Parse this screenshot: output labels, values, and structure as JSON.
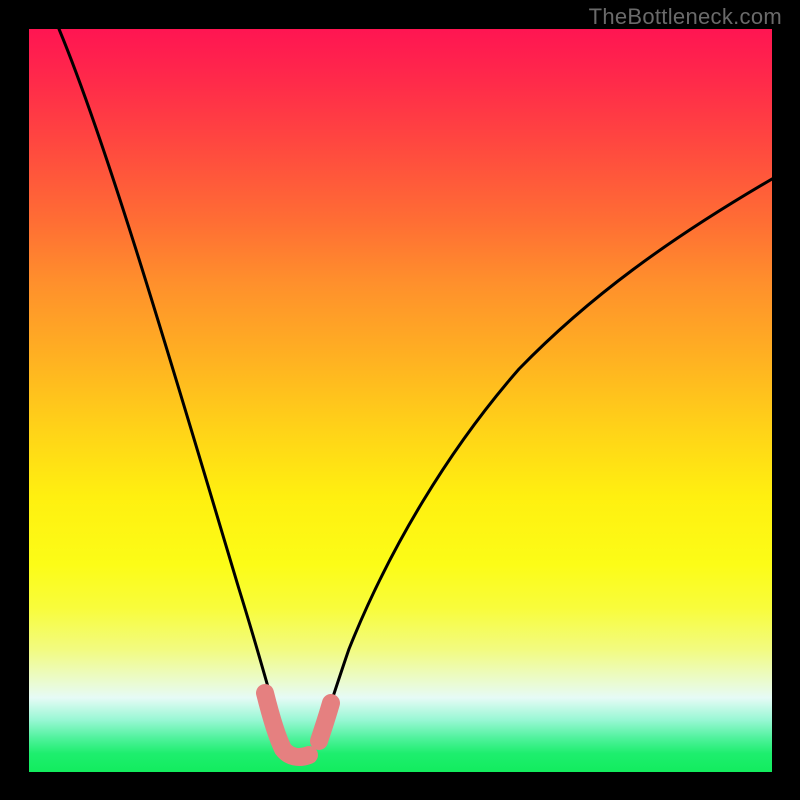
{
  "watermark": "TheBottleneck.com",
  "chart_data": {
    "type": "line",
    "title": "",
    "xlabel": "",
    "ylabel": "",
    "xlim": [
      0,
      100
    ],
    "ylim": [
      0,
      100
    ],
    "series": [
      {
        "name": "black-curve",
        "color": "#000000",
        "x": [
          4,
          8,
          12,
          16,
          20,
          24,
          27,
          29,
          31,
          33,
          33.8,
          35,
          37,
          39,
          41,
          45,
          50,
          56,
          62,
          70,
          78,
          86,
          94,
          100
        ],
        "y": [
          100,
          88,
          74,
          60,
          46,
          32,
          20,
          12,
          6,
          2.6,
          2.2,
          2.2,
          2.6,
          6,
          12,
          22,
          33,
          44,
          53,
          62,
          68.5,
          73.5,
          77.5,
          80
        ]
      },
      {
        "name": "salmon-overlay",
        "color": "#e58080",
        "x": [
          29.5,
          30.5,
          31.5,
          32.5,
          33.5,
          34.0,
          35.0,
          36.0,
          36.7
        ],
        "y": [
          9.0,
          6.0,
          3.6,
          2.4,
          2.2,
          2.2,
          2.2,
          3.2,
          6.8
        ]
      }
    ],
    "gradient_stops": [
      {
        "pos": 0,
        "color": "#ff1552"
      },
      {
        "pos": 7,
        "color": "#ff2a4a"
      },
      {
        "pos": 15,
        "color": "#ff4640"
      },
      {
        "pos": 26,
        "color": "#ff6e34"
      },
      {
        "pos": 34,
        "color": "#ff8f2c"
      },
      {
        "pos": 44,
        "color": "#ffb022"
      },
      {
        "pos": 54,
        "color": "#ffd318"
      },
      {
        "pos": 63,
        "color": "#fff010"
      },
      {
        "pos": 72,
        "color": "#fcfc17"
      },
      {
        "pos": 78,
        "color": "#f8fc3c"
      },
      {
        "pos": 83.5,
        "color": "#f2fb80"
      },
      {
        "pos": 87,
        "color": "#ecfbc0"
      },
      {
        "pos": 90,
        "color": "#e6fbf6"
      },
      {
        "pos": 93,
        "color": "#98f7d4"
      },
      {
        "pos": 95.5,
        "color": "#4ef29b"
      },
      {
        "pos": 97.5,
        "color": "#1eee6e"
      },
      {
        "pos": 100,
        "color": "#12ec5e"
      }
    ]
  }
}
